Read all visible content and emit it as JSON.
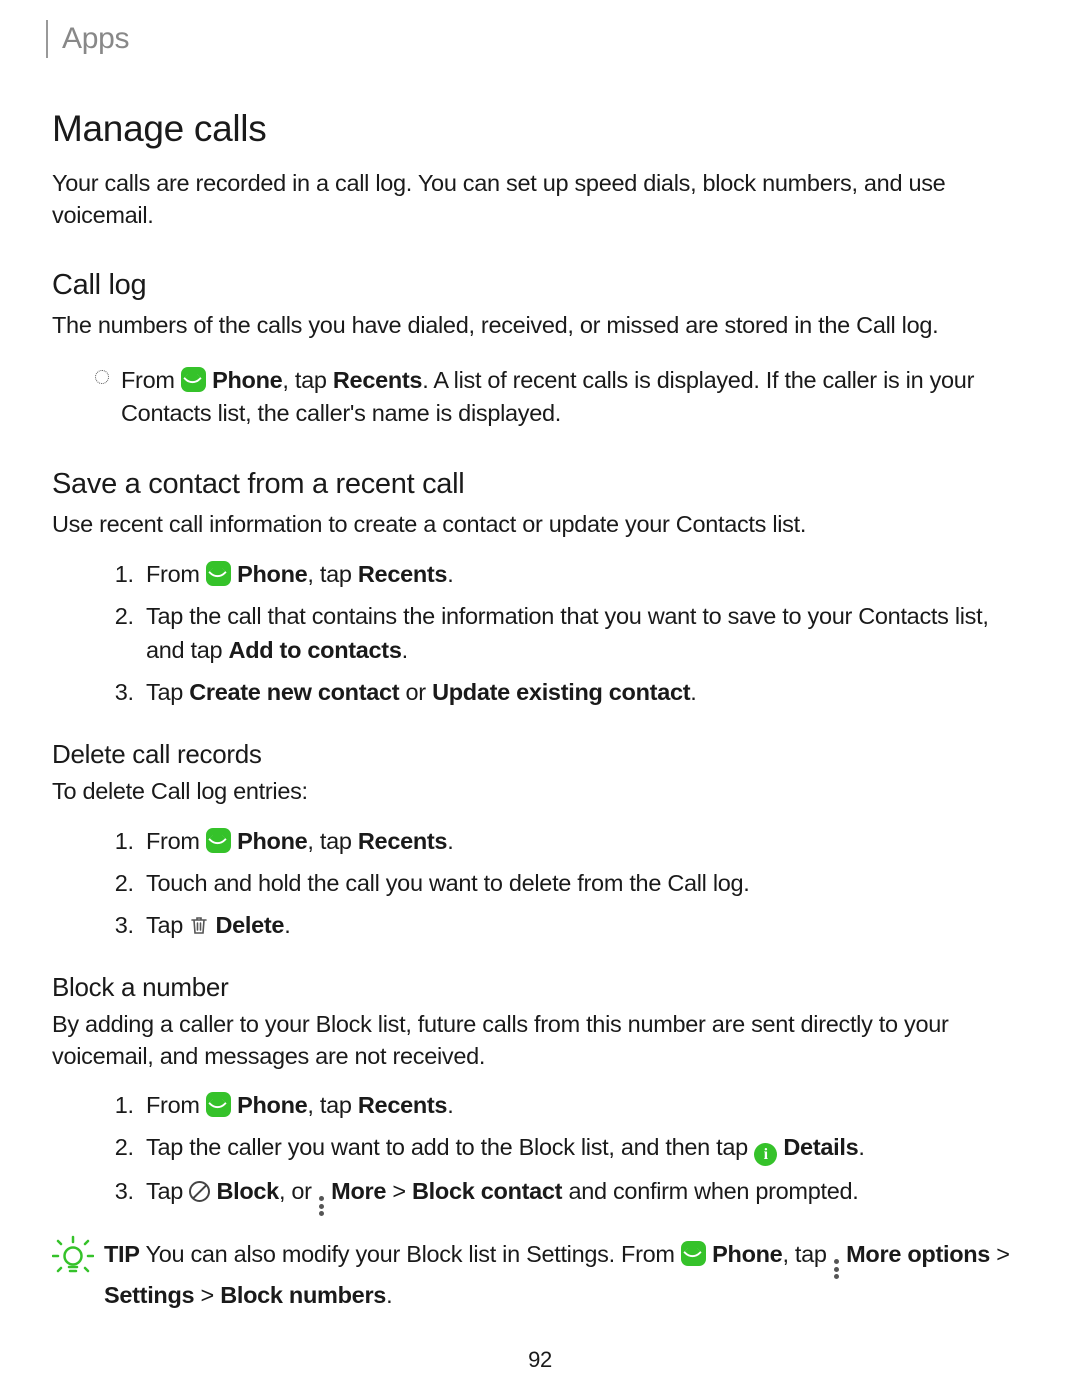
{
  "breadcrumb": "Apps",
  "h1": "Manage calls",
  "intro": "Your calls are recorded in a call log. You can set up speed dials, block numbers, and use voicemail.",
  "call_log": {
    "heading": "Call log",
    "text": "The numbers of the calls you have dialed, received, or missed are stored in the Call log.",
    "bullet": {
      "pre_icon": "From ",
      "phone_label": "Phone",
      "post_phone": ", tap ",
      "recents": "Recents",
      "rest": ". A list of recent calls is displayed. If the caller is in your Contacts list, the caller's name is displayed."
    }
  },
  "save_contact": {
    "heading": "Save a contact from a recent call",
    "text": "Use recent call information to create a contact or update your Contacts list.",
    "steps": {
      "s1_pre": "From ",
      "s1_phone": "Phone",
      "s1_mid": ", tap ",
      "s1_recents": "Recents",
      "s1_end": ".",
      "s2_pre": "Tap the call that contains the information that you want to save to your Contacts list, and tap ",
      "s2_bold": "Add to contacts",
      "s2_end": ".",
      "s3_pre": "Tap ",
      "s3_b1": "Create new contact",
      "s3_mid": " or ",
      "s3_b2": "Update existing contact",
      "s3_end": "."
    }
  },
  "delete_records": {
    "heading": "Delete call records",
    "text": "To delete Call log entries:",
    "steps": {
      "s1_pre": "From ",
      "s1_phone": "Phone",
      "s1_mid": ", tap ",
      "s1_recents": "Recents",
      "s1_end": ".",
      "s2": "Touch and hold the call you want to delete from the Call log.",
      "s3_pre": "Tap ",
      "s3_delete": "Delete",
      "s3_end": "."
    }
  },
  "block_number": {
    "heading": "Block a number",
    "text": "By adding a caller to your Block list, future calls from this number are sent directly to your voicemail, and messages are not received.",
    "steps": {
      "s1_pre": "From ",
      "s1_phone": "Phone",
      "s1_mid": ", tap ",
      "s1_recents": "Recents",
      "s1_end": ".",
      "s2_pre": "Tap the caller you want to add to the Block list, and then tap ",
      "s2_details": "Details",
      "s2_end": ".",
      "s3_pre": "Tap ",
      "s3_block": "Block",
      "s3_mid1": ", or ",
      "s3_more": "More",
      "s3_gt": " > ",
      "s3_bc": "Block contact",
      "s3_rest": " and confirm when prompted."
    }
  },
  "tip": {
    "label": "TIP",
    "pre": "  You can also modify your Block list in Settings. From ",
    "phone": "Phone",
    "mid1": ", tap ",
    "more": "More options",
    "gt1": " > ",
    "settings": "Settings",
    "gt2": " > ",
    "bn": "Block numbers",
    "end": "."
  },
  "page_number": "92",
  "icons": {
    "details_glyph": "i"
  },
  "colors": {
    "accent": "#35c22a"
  }
}
